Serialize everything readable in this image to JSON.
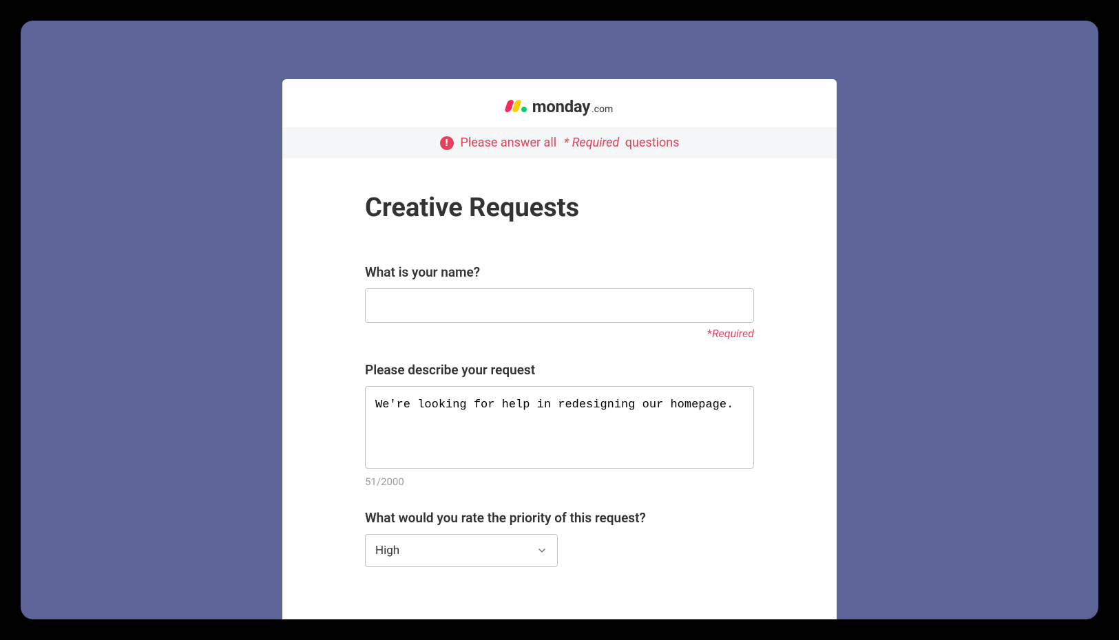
{
  "logo": {
    "brand": "monday",
    "suffix": ".com"
  },
  "error_banner": {
    "prefix": "Please answer all",
    "star": "*",
    "required_word": "Required",
    "suffix": "questions"
  },
  "form": {
    "title": "Creative Requests",
    "name_field": {
      "label": "What is your name?",
      "value": "",
      "required_star": "*",
      "required_label": "Required"
    },
    "describe_field": {
      "label": "Please describe your request",
      "value": "We're looking for help in redesigning our homepage.",
      "counter": "51/2000"
    },
    "priority_field": {
      "label": "What would you rate the priority of this request?",
      "selected": "High"
    }
  }
}
